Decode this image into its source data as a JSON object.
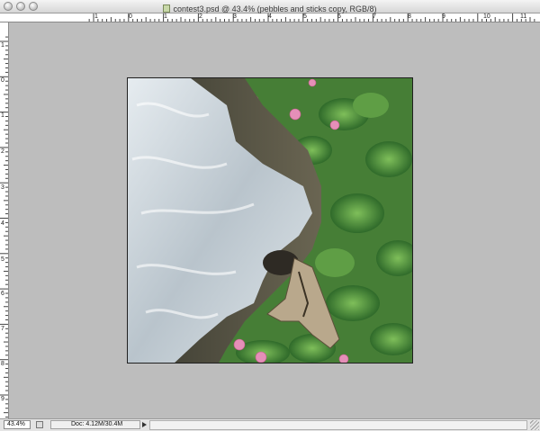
{
  "window": {
    "title": "contest3.psd @ 43.4% (pebbles and sticks copy, RGB/8)"
  },
  "ruler_top": {
    "labels": [
      "1",
      "0",
      "1",
      "2",
      "3",
      "4",
      "5",
      "6",
      "7",
      "8",
      "9",
      "10",
      "11"
    ]
  },
  "ruler_left": {
    "labels": [
      "1",
      "0",
      "1",
      "2",
      "3",
      "4",
      "5",
      "6",
      "7",
      "8",
      "9",
      "1"
    ]
  },
  "status": {
    "zoom": "43.4%",
    "doc_info": "Doc: 4.12M/30.4M"
  },
  "colors": {
    "pasteboard": "#bdbdbd",
    "foliage": "#4f8a3e",
    "fur": "#c9d3da",
    "flowers": "#e58fb8"
  },
  "icons": {
    "window_controls": [
      "close-icon",
      "minimize-icon",
      "zoom-icon"
    ],
    "document": "psd-document-icon",
    "status_menu": "triangle-right-icon",
    "resize": "resize-grip-icon"
  }
}
